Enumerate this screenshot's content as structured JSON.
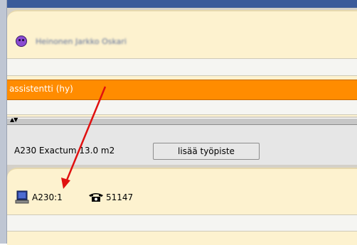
{
  "person": {
    "name": "Heinonen Jarkko Oskari"
  },
  "role": {
    "label": "assistentti (hy)"
  },
  "room": {
    "label": "A230 Exactum 13.0 m2",
    "add_workstation_label": "lisää työpiste"
  },
  "workstation": {
    "id": "A230:1",
    "phone": "51147"
  },
  "icons": [
    "avatar-icon",
    "computer-icon",
    "phone-icon",
    "triangle-up-icon",
    "triangle-down-icon"
  ],
  "colors": {
    "role_bar": "#ff8c00",
    "panel_bg": "#fdf2cf",
    "annotation_arrow": "#e01010",
    "avatar": "#8a4bd2"
  }
}
